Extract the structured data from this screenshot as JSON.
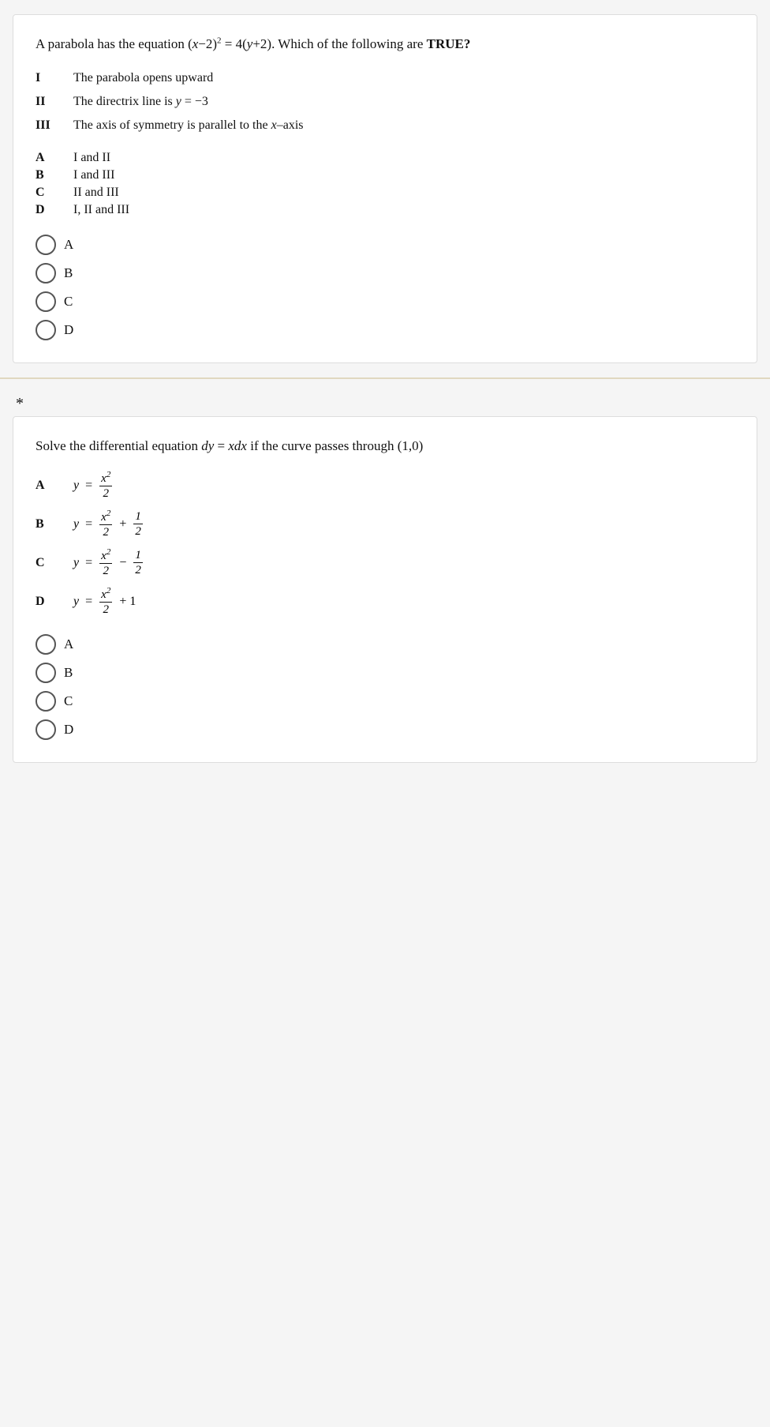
{
  "question1": {
    "text": "A parabola has the equation (x−2)² = 4(y+2). Which of the following are ",
    "bold": "TRUE?",
    "statements": [
      {
        "label": "I",
        "text": "The parabola opens upward"
      },
      {
        "label": "II",
        "text": "The directrix line is y = −3"
      },
      {
        "label": "III",
        "text": "The axis of symmetry is parallel to the x–axis"
      }
    ],
    "options": [
      {
        "label": "A",
        "text": "I and II"
      },
      {
        "label": "B",
        "text": "I and III"
      },
      {
        "label": "C",
        "text": "II and III"
      },
      {
        "label": "D",
        "text": "I, II and III"
      }
    ],
    "radio_options": [
      "A",
      "B",
      "C",
      "D"
    ],
    "selected": null
  },
  "question2": {
    "text": "Solve the differential equation dy = xdx if the curve passes through (1,0)",
    "options": [
      {
        "label": "A",
        "math": "y = x²/2"
      },
      {
        "label": "B",
        "math": "y = x²/2 + 1/2"
      },
      {
        "label": "C",
        "math": "y = x²/2 − 1/2"
      },
      {
        "label": "D",
        "math": "y = x²/2 + 1"
      }
    ],
    "radio_options": [
      "A",
      "B",
      "C",
      "D"
    ],
    "selected": null
  },
  "asterisk": "*"
}
